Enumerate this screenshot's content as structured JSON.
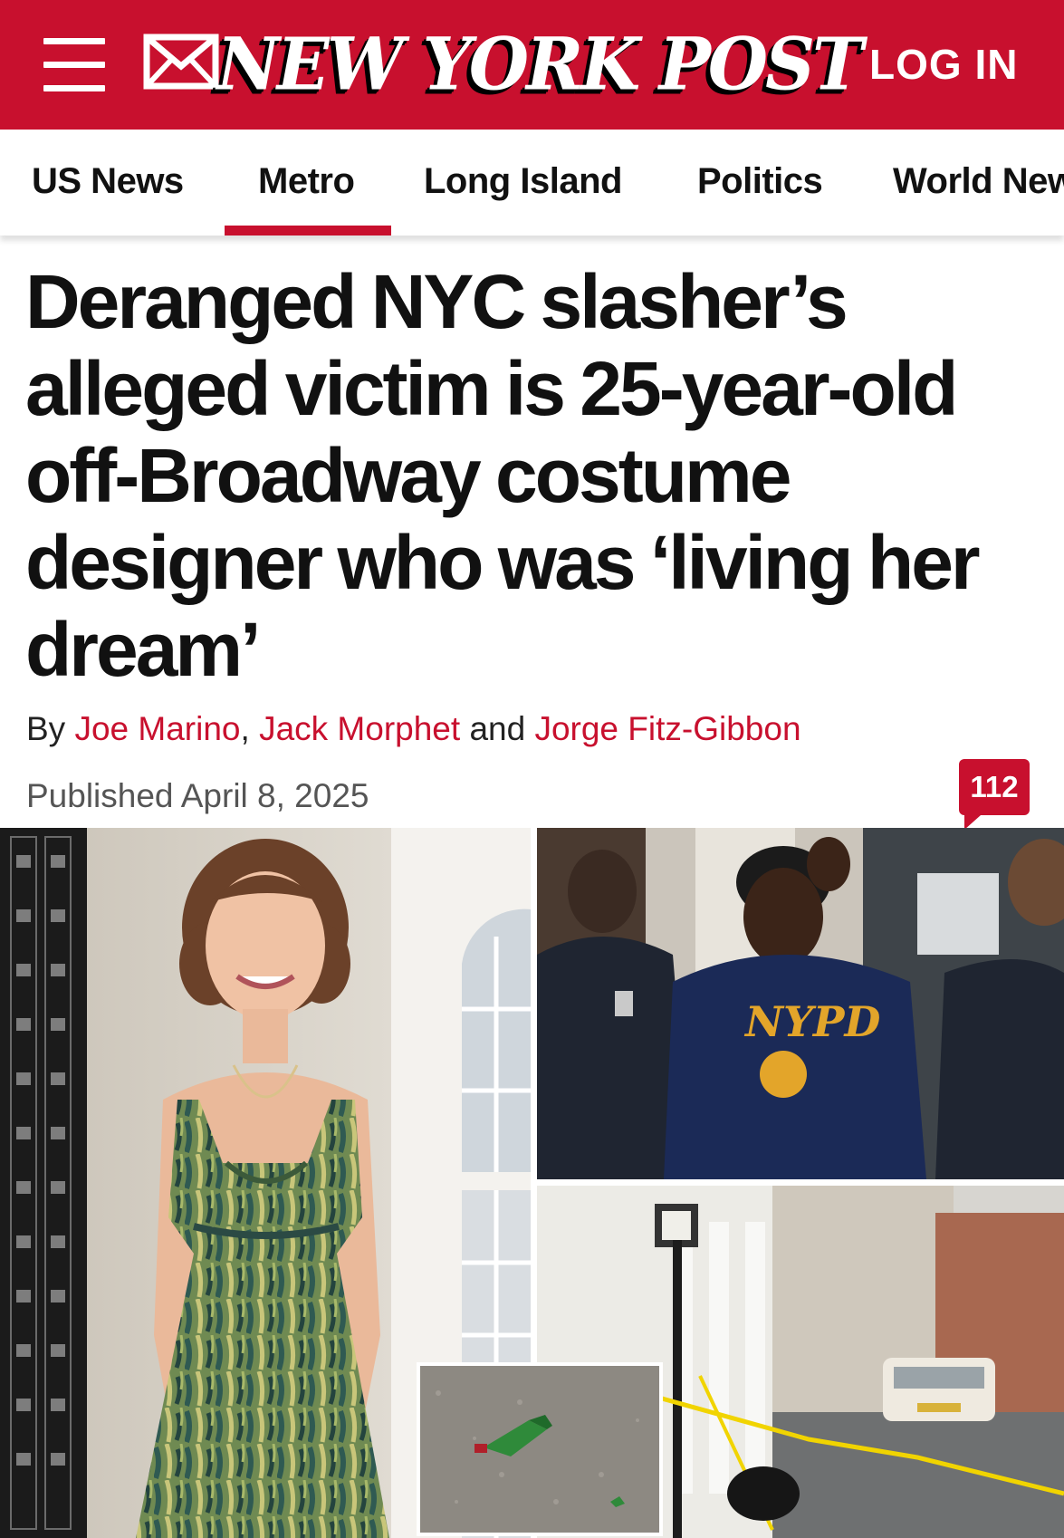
{
  "header": {
    "logo_text": "NEW YORK POST",
    "login_label": "LOG IN",
    "brand_color": "#c8102e",
    "icons": [
      "hamburger-menu-icon",
      "mail-icon"
    ]
  },
  "nav": {
    "active_tab": "Metro",
    "tabs": [
      {
        "label": "US News"
      },
      {
        "label": "Metro"
      },
      {
        "label": "Long Island"
      },
      {
        "label": "Politics"
      },
      {
        "label": "World News"
      }
    ]
  },
  "article": {
    "headline": "Deranged NYC slasher’s alleged victim is 25-year-old off-Broadway costume designer who was ‘living her dream’",
    "byline_prefix": "By",
    "authors": [
      "Joe Marino",
      "Jack Morphet",
      "Jorge Fitz-Gibbon"
    ],
    "byline_separator": ",",
    "byline_and": "and",
    "published": "Published April 8, 2025",
    "comment_count": "112"
  },
  "media": {
    "photos": [
      "Woman in green patterned dress smiling beside a building entrance",
      "Man in NYPD hoodie escorted by police officers",
      "Street scene with police tape and parked car",
      "Inset: broken green glass bottle on pavement"
    ],
    "hoodie_text": "NYPD"
  }
}
